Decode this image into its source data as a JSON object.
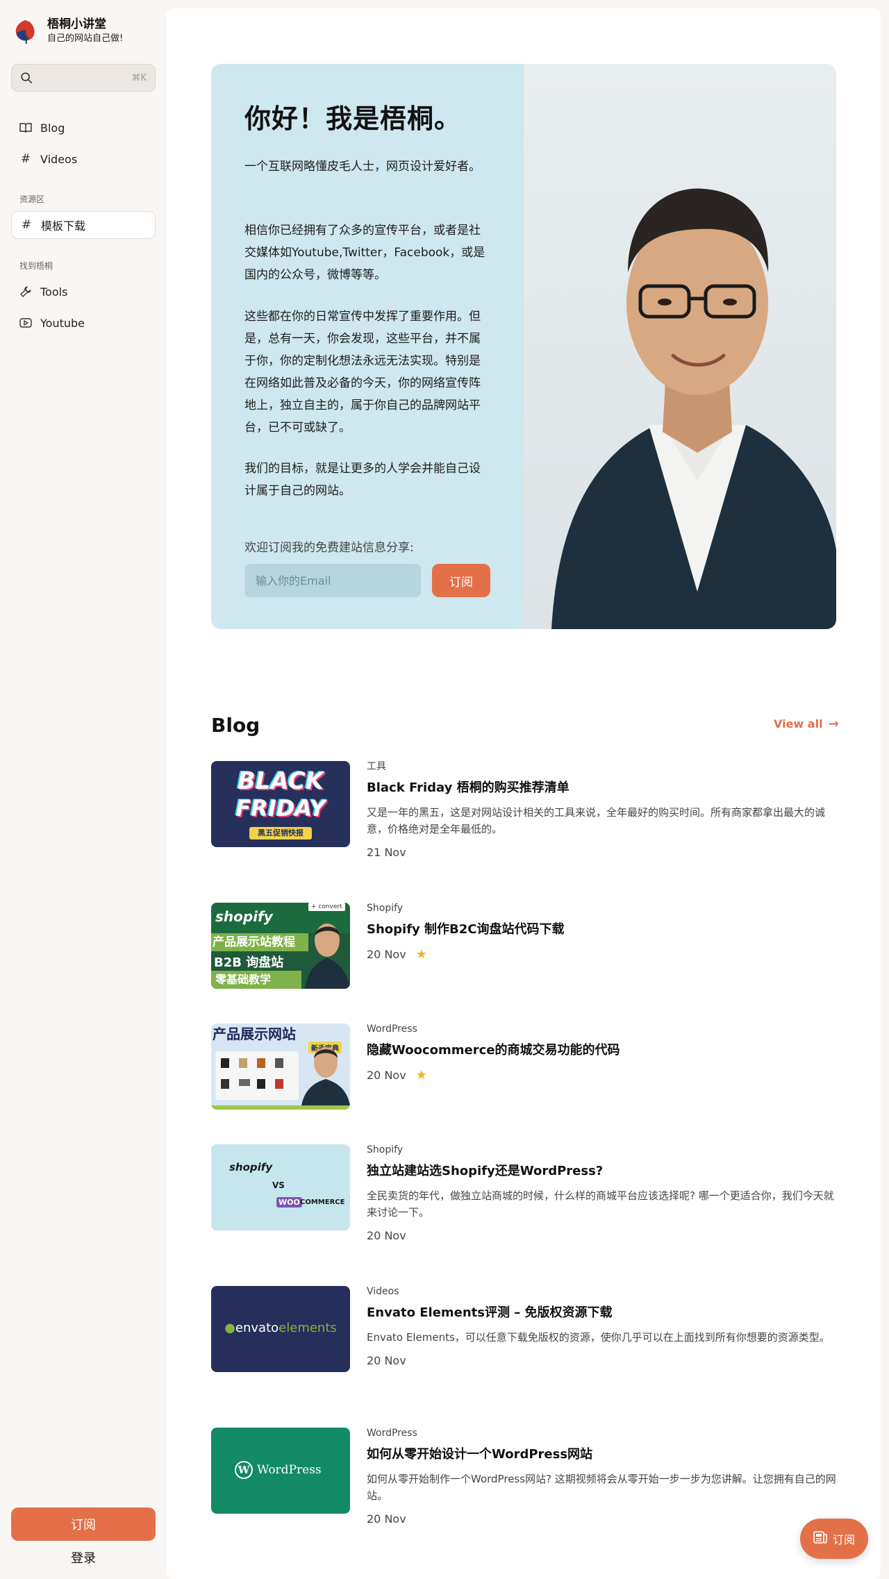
{
  "brand": {
    "name": "梧桐小讲堂",
    "tagline": "自己的网站自己做!"
  },
  "search": {
    "shortcut": "⌘K"
  },
  "nav": {
    "blog": "Blog",
    "videos": "Videos",
    "section_resources": "资源区",
    "templates": "模板下载",
    "section_find": "找到梧桐",
    "tools": "Tools",
    "youtube": "Youtube"
  },
  "sidebar_footer": {
    "subscribe": "订阅",
    "login": "登录"
  },
  "hero": {
    "title": "你好！我是梧桐。",
    "p1": "一个互联网略懂皮毛人士，网页设计爱好者。",
    "p2": "相信你已经拥有了众多的宣传平台，或者是社交媒体如Youtube,Twitter，Facebook，或是国内的公众号，微博等等。",
    "p3": "这些都在你的日常宣传中发挥了重要作用。但是，总有一天，你会发现，这些平台，并不属于你，你的定制化想法永远无法实现。特别是在网络如此普及必备的今天，你的网络宣传阵地上，独立自主的，属于你自己的品牌网站平台，已不可或缺了。",
    "p4": "我们的目标，就是让更多的人学会并能自己设计属于自己的网站。",
    "invite": "欢迎订阅我的免费建站信息分享:",
    "email_placeholder": "输入你的Email",
    "subscribe": "订阅"
  },
  "blog": {
    "title": "Blog",
    "view_all": "View all",
    "posts": [
      {
        "category": "工具",
        "title": "Black Friday 梧桐的购买推荐清单",
        "desc": "又是一年的黑五，这是对网站设计相关的工具来说，全年最好的购买时间。所有商家都拿出最大的诚意，价格绝对是全年最低的。",
        "date": "21 Nov",
        "starred": false,
        "thumb": {
          "line1": "BLACK",
          "line2": "FRIDAY",
          "line3": "黑五促销快报"
        }
      },
      {
        "category": "Shopify",
        "title": "Shopify 制作B2C询盘站代码下载",
        "desc": "",
        "date": "20 Nov",
        "starred": true,
        "thumb": {
          "brand": "shopify",
          "badge": "+ convert",
          "line1": "产品展示站教程",
          "line2": "B2B 询盘站",
          "line3": "零基础教学"
        }
      },
      {
        "category": "WordPress",
        "title": "隐藏Woocommerce的商城交易功能的代码",
        "desc": "",
        "date": "20 Nov",
        "starred": true,
        "thumb": {
          "line1": "产品展示网站",
          "badge": "新手宝典"
        }
      },
      {
        "category": "Shopify",
        "title": "独立站建站选Shopify还是WordPress?",
        "desc": "全民卖货的年代，做独立站商城的时候，什么样的商城平台应该选择呢? 哪一个更适合你，我们今天就来讨论一下。",
        "date": "20 Nov",
        "starred": false,
        "thumb": {
          "brand": "shopify",
          "vs": "VS",
          "woo": "WOO",
          "commerce": "COMMERCE"
        }
      },
      {
        "category": "Videos",
        "title": "Envato Elements评测 – 免版权资源下载",
        "desc": "Envato Elements，可以任意下载免版权的资源，使你几乎可以在上面找到所有你想要的资源类型。",
        "date": "20 Nov",
        "starred": false,
        "thumb": {
          "brand1": "envato",
          "brand2": "elements"
        }
      },
      {
        "category": "WordPress",
        "title": "如何从零开始设计一个WordPress网站",
        "desc": "如何从零开始制作一个WordPress网站? 这期视频将会从零开始一步一步为您讲解。让您拥有自己的网站。",
        "date": "20 Nov",
        "starred": false,
        "thumb": {
          "brand": "WordPress"
        }
      }
    ]
  },
  "fab": {
    "label": "订阅"
  },
  "colors": {
    "accent": "#e4704a",
    "hero_bg": "#cfe7ee",
    "star": "#f0b320"
  }
}
